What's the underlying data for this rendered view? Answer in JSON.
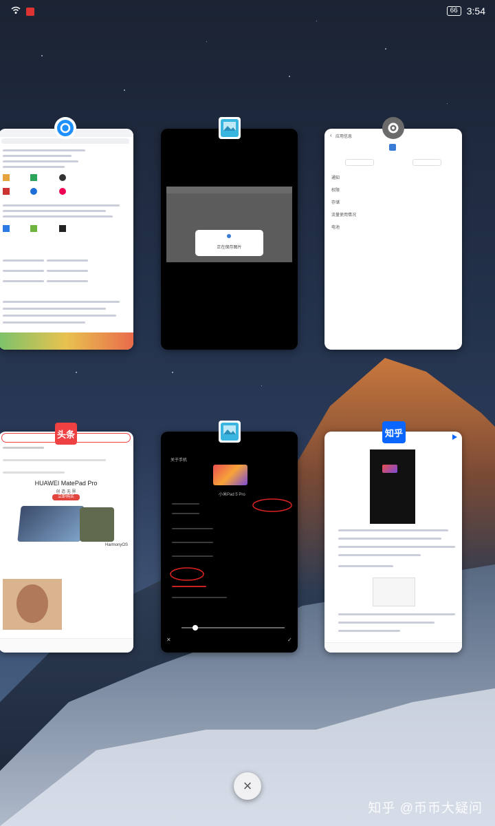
{
  "status_bar": {
    "battery": "66",
    "time": "3:54"
  },
  "cards": [
    {
      "id": "browser",
      "icon": "circle-browser-icon",
      "accent": "#1e90ff"
    },
    {
      "id": "gallery-loading",
      "icon": "gallery-icon",
      "dialog_text": "正在保存图片"
    },
    {
      "id": "settings",
      "icon": "gear-icon",
      "title": "应用信息",
      "items": [
        "通知",
        "权限",
        "存储",
        "流量使用情况",
        "电池"
      ]
    },
    {
      "id": "toutiao",
      "icon": "toutiao-icon",
      "icon_text": "头条",
      "ad_title": "HUAWEI MatePad Pro",
      "ad_sub": "创 造 无 界",
      "ad_btn": "立即购买",
      "ad_brand": "HarmonyOS"
    },
    {
      "id": "gallery-about",
      "icon": "gallery-icon",
      "header": "关于手机",
      "device": "小米Pad 5 Pro"
    },
    {
      "id": "zhihu",
      "icon": "zhihu-icon",
      "icon_text": "知乎"
    }
  ],
  "clear_all_label": "×",
  "watermark": "知乎 @币币大疑问"
}
